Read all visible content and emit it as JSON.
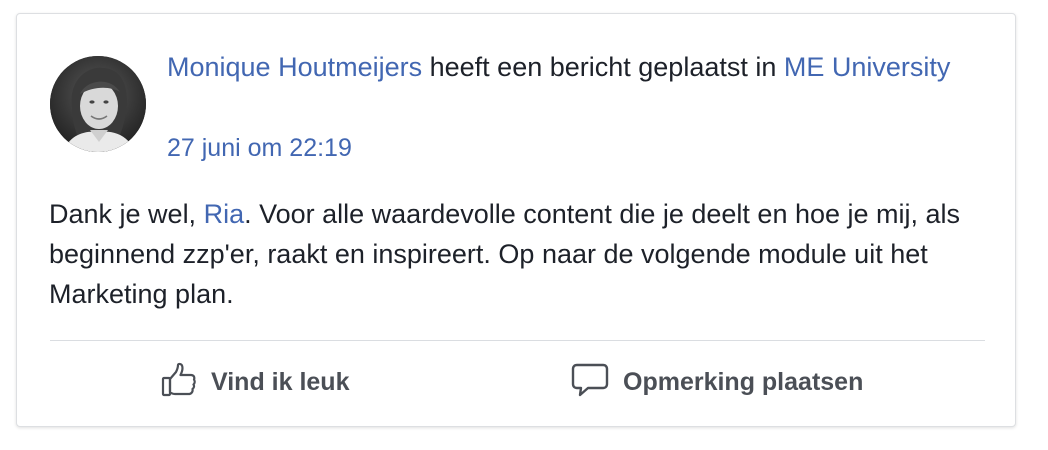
{
  "post": {
    "author": "Monique Houtmeijers",
    "action_text": " heeft een bericht geplaatst in ",
    "group": "ME University",
    "timestamp": "27 juni om 22:19",
    "message": {
      "before_mention": "Dank je wel, ",
      "mention": "Ria",
      "after_mention": ". Voor alle waardevolle content die je deelt en hoe je mij, als beginnend zzp'er, raakt en inspireert. Op naar de volgende module uit het Marketing plan."
    }
  },
  "actions": {
    "like_label": "Vind ik leuk",
    "like_icon": "thumbs-up-icon",
    "comment_label": "Opmerking plaatsen",
    "comment_icon": "speech-bubble-icon"
  },
  "colors": {
    "link": "#4267b2",
    "text": "#1d2129",
    "action_text": "#4b4f56"
  }
}
